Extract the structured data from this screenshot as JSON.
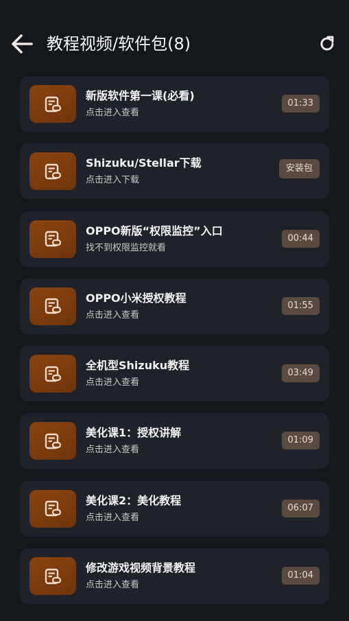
{
  "header": {
    "title": "教程视频/软件包(8)",
    "back_icon": "arrow-left-icon",
    "refresh_icon": "refresh-icon"
  },
  "colors": {
    "background": "#14171b",
    "card": "#1f2329",
    "thumb": "#7c3b0d",
    "badge": "#5a4a40"
  },
  "items": [
    {
      "title": "新版软件第一课(必看)",
      "subtitle": "点击进入查看",
      "badge": "01:33",
      "icon": "document-link-icon"
    },
    {
      "title": "Shizuku/Stellar下载",
      "subtitle": "点击进入下载",
      "badge": "安装包",
      "icon": "document-link-icon"
    },
    {
      "title": "OPPO新版“权限监控”入口",
      "subtitle": "找不到权限监控就看",
      "badge": "00:44",
      "icon": "document-link-icon"
    },
    {
      "title": "OPPO小米授权教程",
      "subtitle": "点击进入查看",
      "badge": "01:55",
      "icon": "document-link-icon"
    },
    {
      "title": "全机型Shizuku教程",
      "subtitle": "点击进入查看",
      "badge": "03:49",
      "icon": "document-link-icon"
    },
    {
      "title": "美化课1：授权讲解",
      "subtitle": "点击进入查看",
      "badge": "01:09",
      "icon": "document-link-icon"
    },
    {
      "title": "美化课2：美化教程",
      "subtitle": "点击进入查看",
      "badge": "06:07",
      "icon": "document-link-icon"
    },
    {
      "title": "修改游戏视频背景教程",
      "subtitle": "点击进入查看",
      "badge": "01:04",
      "icon": "document-link-icon"
    }
  ]
}
